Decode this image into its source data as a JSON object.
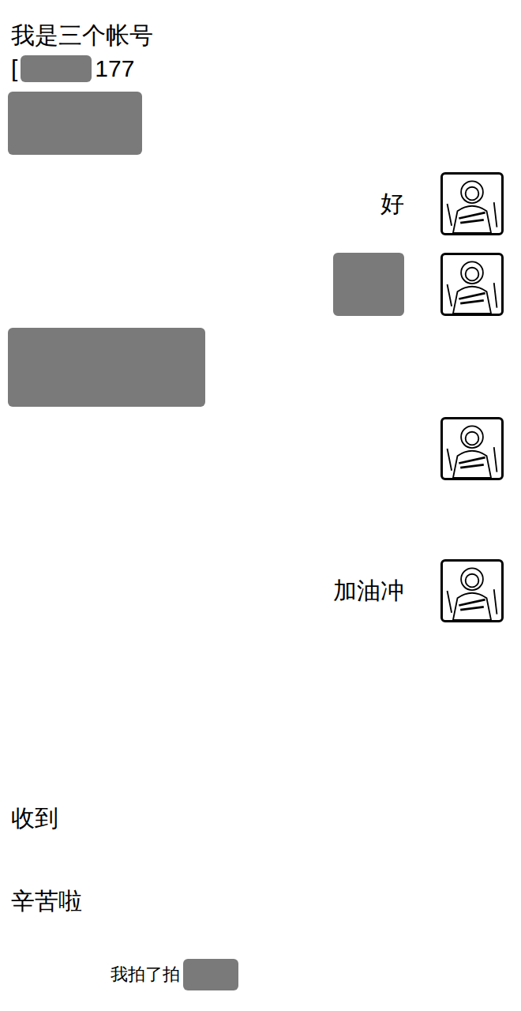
{
  "chat": {
    "messages": [
      {
        "side": "left",
        "kind": "text",
        "text": "我是三个帐号"
      },
      {
        "side": "left",
        "kind": "fragment",
        "text": "[",
        "tail": "177"
      },
      {
        "side": "left",
        "kind": "redacted"
      },
      {
        "side": "right",
        "kind": "text",
        "text": "好"
      },
      {
        "side": "right",
        "kind": "redacted"
      },
      {
        "side": "left",
        "kind": "redacted"
      },
      {
        "side": "right",
        "kind": "blank"
      },
      {
        "side": "right",
        "kind": "text",
        "text": "加油冲"
      },
      {
        "side": "left",
        "kind": "text",
        "text": "收到"
      },
      {
        "side": "left",
        "kind": "text",
        "text": "辛苦啦"
      },
      {
        "side": "center",
        "kind": "system",
        "text": "我拍了拍"
      }
    ]
  }
}
